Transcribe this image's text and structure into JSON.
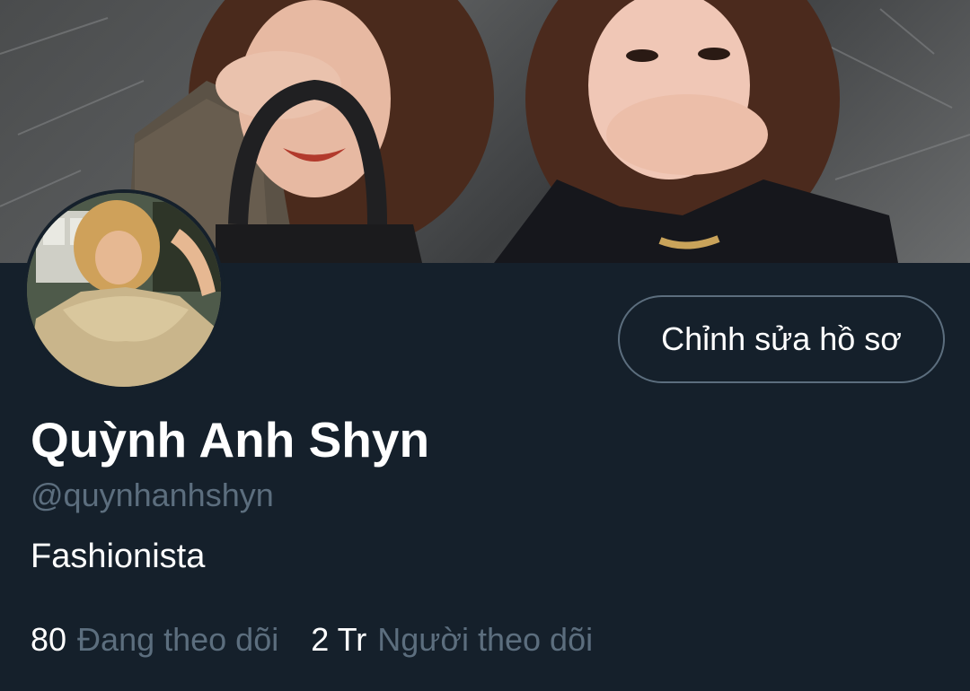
{
  "profile": {
    "display_name": "Quỳnh Anh Shyn",
    "handle": "@quynhanhshyn",
    "bio": "Fashionista",
    "edit_button_label": "Chỉnh sửa hồ sơ",
    "following_count": "80",
    "following_label": "Đang theo dõi",
    "followers_count": "2 Tr",
    "followers_label": "Người theo dõi"
  },
  "colors": {
    "background": "#15202b",
    "text_primary": "#ffffff",
    "text_secondary": "#5c6e7e",
    "button_border": "#5c6e7e"
  },
  "icons": {
    "banner": "banner-photo",
    "avatar": "profile-photo"
  }
}
